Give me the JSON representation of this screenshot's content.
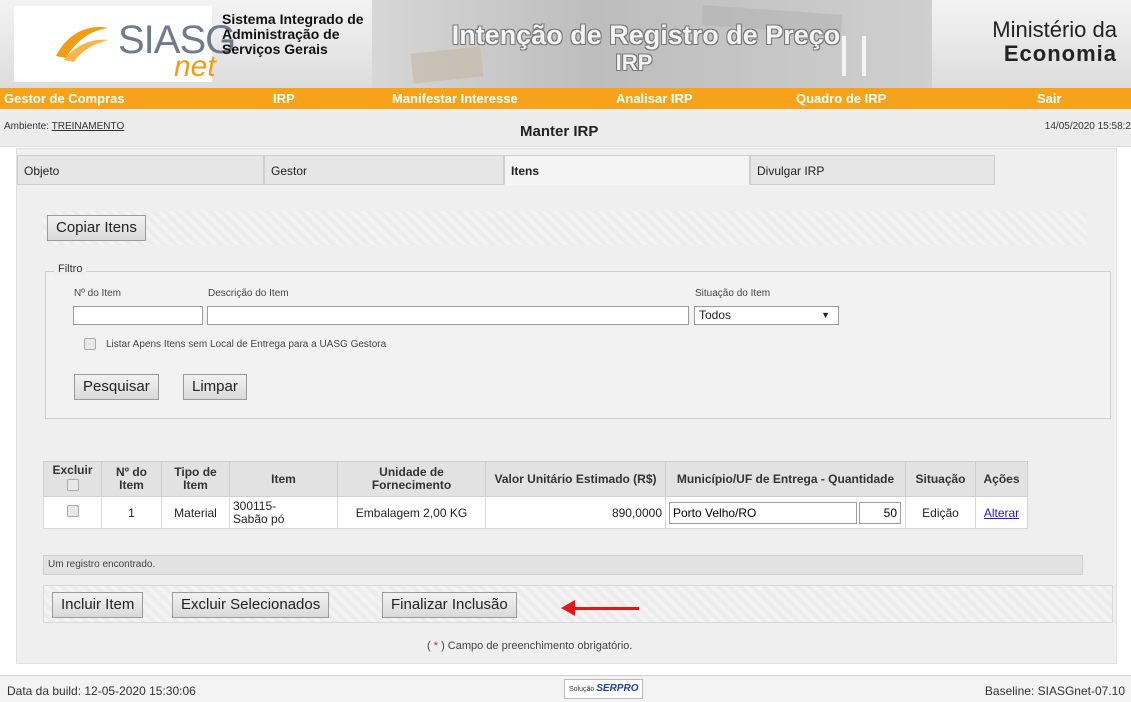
{
  "header": {
    "logo_main": "SIASG",
    "logo_sub": "net",
    "system_name": "Sistema Integrado de\nAdministração de\nServiços Gerais",
    "banner_title": "Intenção de Registro de Preço",
    "banner_subtitle": "IRP",
    "ministry_line1": "Ministério da",
    "ministry_line2": "Economia"
  },
  "nav": {
    "items": [
      "Gestor de Compras",
      "IRP",
      "Manifestar Interesse",
      "Analisar IRP",
      "Quadro de IRP",
      "Sair"
    ]
  },
  "infobar": {
    "ambiente_label": "Ambiente:",
    "ambiente_value": "TREINAMENTO",
    "page_title": "Manter IRP",
    "datetime": "14/05/2020 15:58:2"
  },
  "tabs": [
    "Objeto",
    "Gestor",
    "Itens",
    "Divulgar IRP"
  ],
  "copy_button": "Copiar Itens",
  "filter": {
    "legend": "Filtro",
    "item_number_label": "Nº do Item",
    "item_number_value": "",
    "description_label": "Descrição do Item",
    "description_value": "",
    "status_label": "Situação do Item",
    "status_value": "Todos",
    "checkbox_label": "Listar Apens Itens sem Local de Entrega para a UASG Gestora",
    "search_button": "Pesquisar",
    "clear_button": "Limpar"
  },
  "table": {
    "headers": {
      "excluir": "Excluir",
      "num": "Nº do Item",
      "tipo": "Tipo de Item",
      "item": "Item",
      "unidade": "Unidade de Fornecimento",
      "valor": "Valor Unitário Estimado (R$)",
      "municipio": "Município/UF de Entrega - Quantidade",
      "situacao": "Situação",
      "acoes": "Ações"
    },
    "rows": [
      {
        "num": "1",
        "tipo": "Material",
        "item": "300115-\nSabão pó",
        "unidade": "Embalagem 2,00 KG",
        "valor": "890,0000",
        "municipio": "Porto Velho/RO",
        "quantidade": "50",
        "situacao": "Edição",
        "acao": "Alterar"
      }
    ]
  },
  "status_message": "Um registro encontrado.",
  "actions": {
    "include_item": "Incluir Item",
    "delete_selected": "Excluir Selecionados",
    "finish_inclusion": "Finalizar Inclusão"
  },
  "required_note": {
    "prefix": "(",
    "asterisk": " * ",
    "suffix": ") Campo de preenchimento obrigatório."
  },
  "footer": {
    "build": "Data da build: 12-05-2020 15:30:06",
    "serpro_prefix": "Solução",
    "serpro_name": "SERPRO",
    "baseline": "Baseline: SIASGnet-07.10"
  },
  "colors": {
    "nav_orange": "#f7a21b",
    "link_blue": "#1a1ad0",
    "arrow_red": "#e01818"
  }
}
